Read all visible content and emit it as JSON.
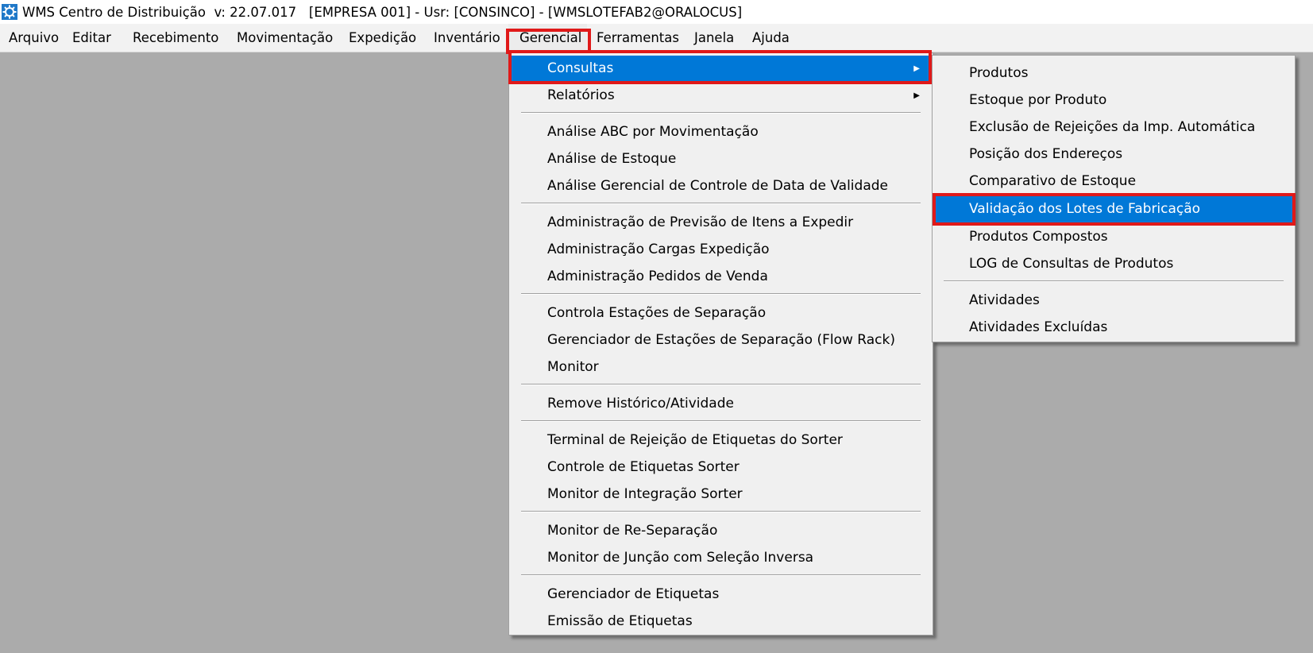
{
  "window": {
    "title": "WMS Centro de Distribuição  v: 22.07.017   [EMPRESA 001] - Usr: [CONSINCO] - [WMSLOTEFAB2@ORALOCUS]",
    "icon": "gear-app-icon"
  },
  "menubar": {
    "items": [
      {
        "label": "Arquivo"
      },
      {
        "label": "Editar"
      },
      {
        "label": "Recebimento"
      },
      {
        "label": "Movimentação"
      },
      {
        "label": "Expedição"
      },
      {
        "label": "Inventário"
      },
      {
        "label": "Gerencial"
      },
      {
        "label": "Ferramentas"
      },
      {
        "label": "Janela"
      },
      {
        "label": "Ajuda"
      }
    ],
    "open_item": "Gerencial"
  },
  "gerencial_menu": {
    "items": [
      {
        "label": "Consultas",
        "submenu": true,
        "active": true
      },
      {
        "label": "Relatórios",
        "submenu": true
      },
      {
        "label": "Análise ABC por Movimentação"
      },
      {
        "label": "Análise de Estoque"
      },
      {
        "label": "Análise Gerencial de Controle de Data de Validade"
      },
      {
        "label": "Administração de Previsão de Itens a Expedir"
      },
      {
        "label": "Administração Cargas Expedição"
      },
      {
        "label": "Administração Pedidos de Venda"
      },
      {
        "label": "Controla Estações de Separação"
      },
      {
        "label": "Gerenciador de Estações de Separação (Flow Rack)"
      },
      {
        "label": "Monitor"
      },
      {
        "label": "Remove Histórico/Atividade"
      },
      {
        "label": "Terminal de Rejeição de Etiquetas do Sorter"
      },
      {
        "label": "Controle de Etiquetas Sorter"
      },
      {
        "label": "Monitor de Integração Sorter"
      },
      {
        "label": "Monitor de Re-Separação"
      },
      {
        "label": "Monitor de Junção com Seleção Inversa"
      },
      {
        "label": "Gerenciador de Etiquetas"
      },
      {
        "label": "Emissão de Etiquetas"
      }
    ]
  },
  "consultas_submenu": {
    "items": [
      {
        "label": "Produtos"
      },
      {
        "label": "Estoque por Produto"
      },
      {
        "label": "Exclusão de Rejeições da Imp. Automática"
      },
      {
        "label": "Posição dos Endereços"
      },
      {
        "label": "Comparativo de Estoque"
      },
      {
        "label": "Validação dos Lotes de Fabricação",
        "active": true
      },
      {
        "label": "Produtos Compostos"
      },
      {
        "label": "LOG de Consultas de Produtos"
      },
      {
        "label": "Atividades"
      },
      {
        "label": "Atividades Excluídas"
      }
    ]
  },
  "colors": {
    "highlight": "#0078d7",
    "annotation_box": "#e01919",
    "workspace": "#ababab"
  }
}
